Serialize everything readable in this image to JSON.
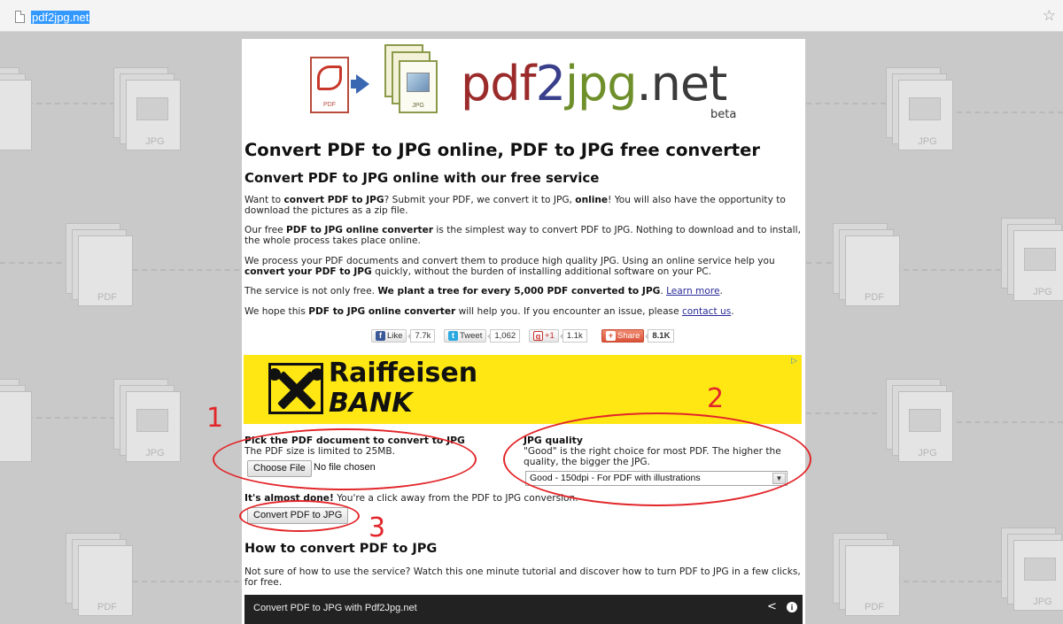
{
  "browser": {
    "url": "pdf2jpg.net"
  },
  "background": {
    "pdf_label": "PDF",
    "jpg_label": "JPG"
  },
  "logo": {
    "part1": "pdf",
    "part2": "2",
    "part3": "jpg",
    "part4": ".net",
    "beta": "beta",
    "pdf_doc_label": "PDF",
    "jpg_doc_label": "JPG"
  },
  "heading": "Convert PDF to JPG online, PDF to JPG free converter",
  "subheading": "Convert PDF to JPG online with our free service",
  "paragraphs": {
    "p1": {
      "a": "Want to ",
      "b": "convert PDF to JPG",
      "c": "? Submit your PDF, we convert it to JPG, ",
      "d": "online",
      "e": "! You will also have the opportunity to download the pictures as a zip file."
    },
    "p2": {
      "a": "Our free ",
      "b": "PDF to JPG online converter",
      "c": " is the simplest way to convert PDF to JPG. Nothing to download and to install, the whole process takes place online."
    },
    "p3": {
      "a": "We process your PDF documents and convert them to produce high quality JPG. Using an online service help you ",
      "b": "convert your PDF to JPG",
      "c": " quickly, without the burden of installing additional software on your PC."
    },
    "p4": {
      "a": "The service is not only free. ",
      "b": "We plant a tree for every 5,000 PDF converted to JPG",
      "c": ". ",
      "link": "Learn more",
      "d": "."
    },
    "p5": {
      "a": "We hope this ",
      "b": "PDF to JPG online converter",
      "c": " will help you. If you encounter an issue, please ",
      "link": "contact us",
      "d": "."
    }
  },
  "social": {
    "like_label": "Like",
    "like_count": "7.7k",
    "tweet_label": "Tweet",
    "tweet_count": "1,062",
    "gplus_label": "+1",
    "gplus_count": "1.1k",
    "share_label": "Share",
    "share_count": "8.1K"
  },
  "ad": {
    "brand_line1": "Raiffeisen",
    "brand_line2": "BANK",
    "ad_badge": "▷"
  },
  "form": {
    "file_title": "Pick the PDF document to convert to JPG",
    "file_sub": "The PDF size is limited to 25MB.",
    "choose_label": "Choose File",
    "no_file": "No file chosen",
    "quality_title": "JPG quality",
    "quality_desc": "\"Good\" is the right choice for most PDF. The higher the quality, the bigger the JPG.",
    "quality_selected": "Good - 150dpi - For PDF with illustrations",
    "almost_bold": "It's almost done!",
    "almost_rest": " You're a click away from the PDF to JPG conversion.",
    "convert_label": "Convert PDF to JPG"
  },
  "howto": {
    "title": "How to convert PDF to JPG",
    "text": "Not sure of how to use the service? Watch this one minute tutorial and discover how to turn PDF to JPG in a few clicks, for free.",
    "video_title": "Convert PDF to JPG with Pdf2Jpg.net"
  },
  "annotations": {
    "n1": "1",
    "n2": "2",
    "n3": "3"
  },
  "colors": {
    "annotation": "#e2262a",
    "ad_yellow": "#ffe714",
    "link": "#2a2a9a"
  }
}
